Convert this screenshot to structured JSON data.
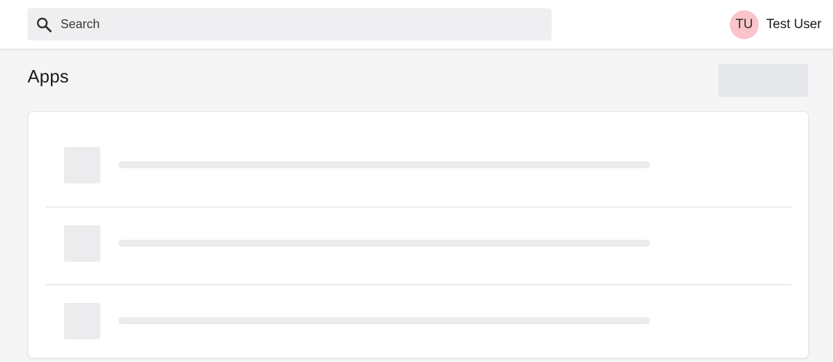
{
  "header": {
    "search": {
      "placeholder": "Search",
      "value": "",
      "icon": "search-icon"
    },
    "user": {
      "initials": "TU",
      "name": "Test User",
      "avatar_color": "#fbc4ca"
    }
  },
  "main": {
    "title": "Apps",
    "loading": true,
    "skeleton_rows": 3
  },
  "colors": {
    "background": "#f5f5f5",
    "topbar": "#ffffff",
    "skeleton": "#ececee",
    "divider": "#d9d9d9"
  }
}
